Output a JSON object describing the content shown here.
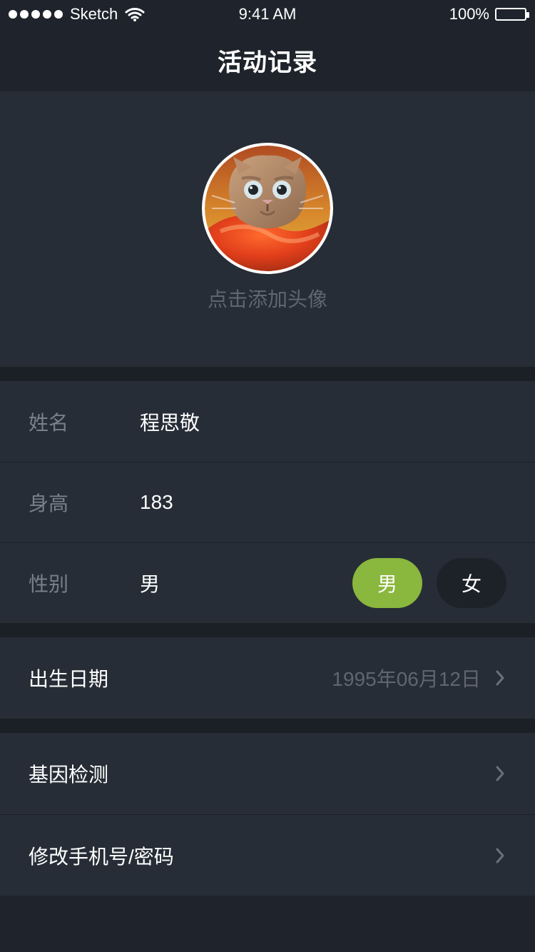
{
  "status_bar": {
    "carrier": "Sketch",
    "time": "9:41 AM",
    "battery": "100%"
  },
  "nav": {
    "title": "活动记录"
  },
  "profile": {
    "avatar_hint": "点击添加头像",
    "fields": {
      "name": {
        "label": "姓名",
        "value": "程思敬"
      },
      "height": {
        "label": "身高",
        "value": "183"
      },
      "gender": {
        "label": "性别",
        "value": "男",
        "options": [
          "男",
          "女"
        ],
        "selected": "男"
      }
    }
  },
  "birth": {
    "label": "出生日期",
    "value": "1995年06月12日"
  },
  "settings": {
    "items": [
      {
        "label": "基因检测"
      },
      {
        "label": "修改手机号/密码"
      }
    ]
  },
  "icons": {
    "wifi": "wifi-icon",
    "battery": "battery-icon",
    "chevron": "chevron-right-icon"
  },
  "colors": {
    "background": "#1f242c",
    "panel": "#272d36",
    "accent": "#8ab73e"
  }
}
